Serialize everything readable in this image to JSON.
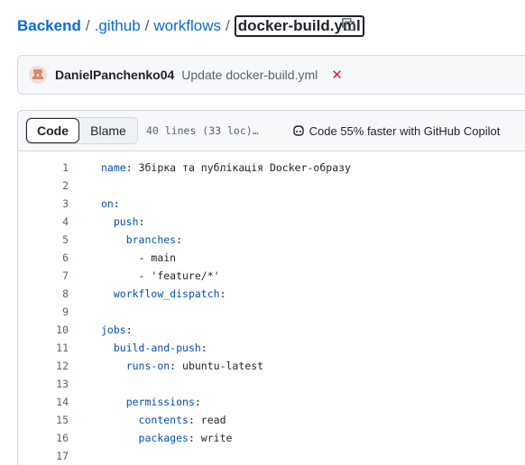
{
  "breadcrumb": {
    "items": [
      "Backend",
      ".github",
      "workflows"
    ],
    "separator": "/",
    "current_file": "docker-build.yml"
  },
  "commit": {
    "author": "DanielPanchenko04",
    "message": "Update docker-build.yml",
    "status": "failed",
    "status_symbol": "✕",
    "status_color": "#d1242f"
  },
  "file_header": {
    "code_tab": "Code",
    "blame_tab": "Blame",
    "lines_info": "40 lines (33 loc)…",
    "copilot_label": "Code 55% faster with GitHub Copilot"
  },
  "code_lines": [
    {
      "n": "1",
      "indent": "",
      "key": "name",
      "sep": ":",
      "val": " Збірка та публікація Docker-образу"
    },
    {
      "n": "2",
      "indent": "",
      "key": "",
      "sep": "",
      "val": ""
    },
    {
      "n": "3",
      "indent": "",
      "key": "on",
      "sep": ":",
      "val": ""
    },
    {
      "n": "4",
      "indent": "  ",
      "key": "push",
      "sep": ":",
      "val": ""
    },
    {
      "n": "5",
      "indent": "    ",
      "key": "branches",
      "sep": ":",
      "val": ""
    },
    {
      "n": "6",
      "indent": "      ",
      "key": "",
      "sep": "",
      "val": "- main"
    },
    {
      "n": "7",
      "indent": "      ",
      "key": "",
      "sep": "",
      "val": "- 'feature/*'"
    },
    {
      "n": "8",
      "indent": "  ",
      "key": "workflow_dispatch",
      "sep": ":",
      "val": ""
    },
    {
      "n": "9",
      "indent": "",
      "key": "",
      "sep": "",
      "val": ""
    },
    {
      "n": "10",
      "indent": "",
      "key": "jobs",
      "sep": ":",
      "val": ""
    },
    {
      "n": "11",
      "indent": "  ",
      "key": "build-and-push",
      "sep": ":",
      "val": ""
    },
    {
      "n": "12",
      "indent": "    ",
      "key": "runs-on",
      "sep": ":",
      "val": " ubuntu-latest"
    },
    {
      "n": "13",
      "indent": "",
      "key": "",
      "sep": "",
      "val": ""
    },
    {
      "n": "14",
      "indent": "    ",
      "key": "permissions",
      "sep": ":",
      "val": ""
    },
    {
      "n": "15",
      "indent": "      ",
      "key": "contents",
      "sep": ":",
      "val": " read"
    },
    {
      "n": "16",
      "indent": "      ",
      "key": "packages",
      "sep": ":",
      "val": " write"
    },
    {
      "n": "17",
      "indent": "",
      "key": "",
      "sep": "",
      "val": ""
    }
  ],
  "colors": {
    "link": "#0969da",
    "yaml_key": "#0550ae",
    "line_number": "#59636e"
  },
  "icons": {
    "copy": "copy-icon",
    "avatar": "avatar-icon",
    "status": "x-icon",
    "copilot": "copilot-icon"
  }
}
